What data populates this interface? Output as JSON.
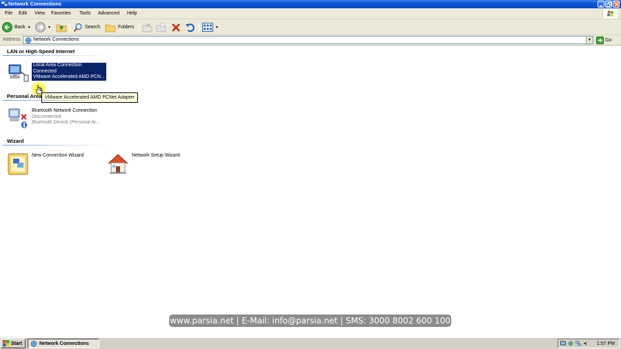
{
  "window": {
    "title": "Network Connections"
  },
  "menu": [
    "File",
    "Edit",
    "View",
    "Favorites",
    "Tools",
    "Advanced",
    "Help"
  ],
  "toolbar": {
    "back_label": "Back",
    "search_label": "Search",
    "folders_label": "Folders"
  },
  "address": {
    "label": "Address",
    "value": "Network Connections",
    "go_label": "Go"
  },
  "groups": {
    "lan": {
      "heading": "LAN or High-Speed Internet",
      "items": [
        {
          "name": "Local Area Connection",
          "status": "Connected",
          "device": "VMware Accelerated AMD PCN..."
        }
      ]
    },
    "personal_area": {
      "heading": "Personal Area",
      "items": [
        {
          "name": "Bluetooth Network Connection",
          "status": "Disconnected",
          "device": "Bluetooth Device (Personal Ar..."
        }
      ]
    },
    "wizard": {
      "heading": "Wizard",
      "items": [
        {
          "name": "New Connection Wizard"
        },
        {
          "name": "Network Setup Wizard"
        }
      ]
    }
  },
  "tooltip": "VMware Accelerated AMD PCNet Adapter",
  "watermark": "www.parsia.net | E-Mail: info@parsia.net | SMS: 3000 8002 600 100",
  "taskbar": {
    "start_label": "Start",
    "task_label": "Network Connections",
    "clock": "1:57 PM"
  },
  "colors": {
    "title_bar": "#0b54d8",
    "selection": "#0a246a",
    "tooltip_bg": "#ffffe1",
    "toolbar_bg": "#ece9d8"
  }
}
